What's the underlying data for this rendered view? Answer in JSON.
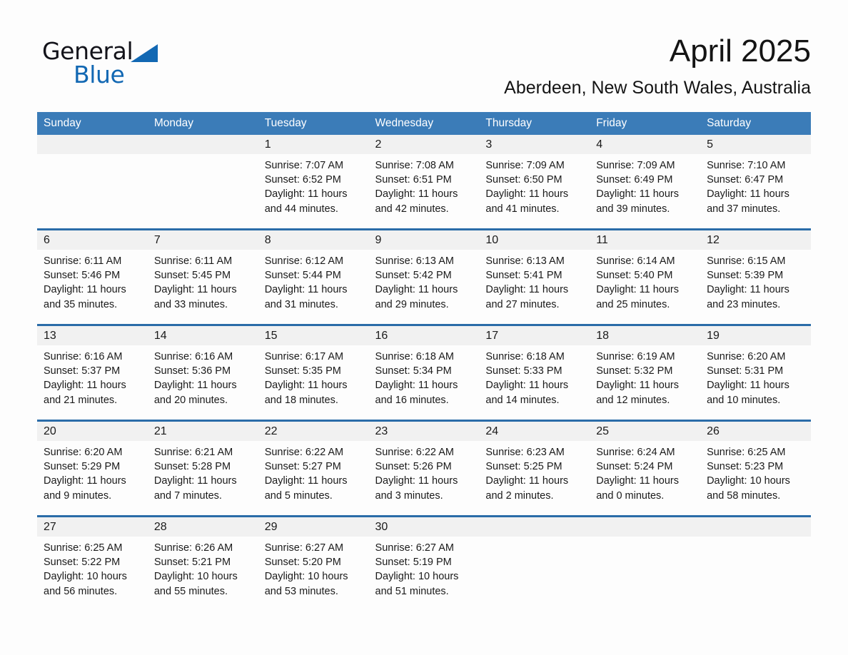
{
  "brand": {
    "name_part1": "General",
    "name_part2": "Blue",
    "accent_color": "#1268b3",
    "triangle_icon": "brand-triangle-icon"
  },
  "header": {
    "title": "April 2025",
    "subtitle": "Aberdeen, New South Wales, Australia"
  },
  "theme": {
    "header_row_blue": "#3b7cb8",
    "row_separator_blue": "#2a6ca8",
    "daynum_band_grey": "#f1f1f1",
    "page_background": "#fdfdfd",
    "text_color": "#1a1a1a"
  },
  "weekday_headers": [
    "Sunday",
    "Monday",
    "Tuesday",
    "Wednesday",
    "Thursday",
    "Friday",
    "Saturday"
  ],
  "labels": {
    "sunrise_prefix": "Sunrise:",
    "sunset_prefix": "Sunset:",
    "daylight_prefix": "Daylight:"
  },
  "weeks": [
    [
      {
        "day": "",
        "sunrise": "",
        "sunset": "",
        "daylight": ""
      },
      {
        "day": "",
        "sunrise": "",
        "sunset": "",
        "daylight": ""
      },
      {
        "day": "1",
        "sunrise": "Sunrise: 7:07 AM",
        "sunset": "Sunset: 6:52 PM",
        "daylight": "Daylight: 11 hours and 44 minutes."
      },
      {
        "day": "2",
        "sunrise": "Sunrise: 7:08 AM",
        "sunset": "Sunset: 6:51 PM",
        "daylight": "Daylight: 11 hours and 42 minutes."
      },
      {
        "day": "3",
        "sunrise": "Sunrise: 7:09 AM",
        "sunset": "Sunset: 6:50 PM",
        "daylight": "Daylight: 11 hours and 41 minutes."
      },
      {
        "day": "4",
        "sunrise": "Sunrise: 7:09 AM",
        "sunset": "Sunset: 6:49 PM",
        "daylight": "Daylight: 11 hours and 39 minutes."
      },
      {
        "day": "5",
        "sunrise": "Sunrise: 7:10 AM",
        "sunset": "Sunset: 6:47 PM",
        "daylight": "Daylight: 11 hours and 37 minutes."
      }
    ],
    [
      {
        "day": "6",
        "sunrise": "Sunrise: 6:11 AM",
        "sunset": "Sunset: 5:46 PM",
        "daylight": "Daylight: 11 hours and 35 minutes."
      },
      {
        "day": "7",
        "sunrise": "Sunrise: 6:11 AM",
        "sunset": "Sunset: 5:45 PM",
        "daylight": "Daylight: 11 hours and 33 minutes."
      },
      {
        "day": "8",
        "sunrise": "Sunrise: 6:12 AM",
        "sunset": "Sunset: 5:44 PM",
        "daylight": "Daylight: 11 hours and 31 minutes."
      },
      {
        "day": "9",
        "sunrise": "Sunrise: 6:13 AM",
        "sunset": "Sunset: 5:42 PM",
        "daylight": "Daylight: 11 hours and 29 minutes."
      },
      {
        "day": "10",
        "sunrise": "Sunrise: 6:13 AM",
        "sunset": "Sunset: 5:41 PM",
        "daylight": "Daylight: 11 hours and 27 minutes."
      },
      {
        "day": "11",
        "sunrise": "Sunrise: 6:14 AM",
        "sunset": "Sunset: 5:40 PM",
        "daylight": "Daylight: 11 hours and 25 minutes."
      },
      {
        "day": "12",
        "sunrise": "Sunrise: 6:15 AM",
        "sunset": "Sunset: 5:39 PM",
        "daylight": "Daylight: 11 hours and 23 minutes."
      }
    ],
    [
      {
        "day": "13",
        "sunrise": "Sunrise: 6:16 AM",
        "sunset": "Sunset: 5:37 PM",
        "daylight": "Daylight: 11 hours and 21 minutes."
      },
      {
        "day": "14",
        "sunrise": "Sunrise: 6:16 AM",
        "sunset": "Sunset: 5:36 PM",
        "daylight": "Daylight: 11 hours and 20 minutes."
      },
      {
        "day": "15",
        "sunrise": "Sunrise: 6:17 AM",
        "sunset": "Sunset: 5:35 PM",
        "daylight": "Daylight: 11 hours and 18 minutes."
      },
      {
        "day": "16",
        "sunrise": "Sunrise: 6:18 AM",
        "sunset": "Sunset: 5:34 PM",
        "daylight": "Daylight: 11 hours and 16 minutes."
      },
      {
        "day": "17",
        "sunrise": "Sunrise: 6:18 AM",
        "sunset": "Sunset: 5:33 PM",
        "daylight": "Daylight: 11 hours and 14 minutes."
      },
      {
        "day": "18",
        "sunrise": "Sunrise: 6:19 AM",
        "sunset": "Sunset: 5:32 PM",
        "daylight": "Daylight: 11 hours and 12 minutes."
      },
      {
        "day": "19",
        "sunrise": "Sunrise: 6:20 AM",
        "sunset": "Sunset: 5:31 PM",
        "daylight": "Daylight: 11 hours and 10 minutes."
      }
    ],
    [
      {
        "day": "20",
        "sunrise": "Sunrise: 6:20 AM",
        "sunset": "Sunset: 5:29 PM",
        "daylight": "Daylight: 11 hours and 9 minutes."
      },
      {
        "day": "21",
        "sunrise": "Sunrise: 6:21 AM",
        "sunset": "Sunset: 5:28 PM",
        "daylight": "Daylight: 11 hours and 7 minutes."
      },
      {
        "day": "22",
        "sunrise": "Sunrise: 6:22 AM",
        "sunset": "Sunset: 5:27 PM",
        "daylight": "Daylight: 11 hours and 5 minutes."
      },
      {
        "day": "23",
        "sunrise": "Sunrise: 6:22 AM",
        "sunset": "Sunset: 5:26 PM",
        "daylight": "Daylight: 11 hours and 3 minutes."
      },
      {
        "day": "24",
        "sunrise": "Sunrise: 6:23 AM",
        "sunset": "Sunset: 5:25 PM",
        "daylight": "Daylight: 11 hours and 2 minutes."
      },
      {
        "day": "25",
        "sunrise": "Sunrise: 6:24 AM",
        "sunset": "Sunset: 5:24 PM",
        "daylight": "Daylight: 11 hours and 0 minutes."
      },
      {
        "day": "26",
        "sunrise": "Sunrise: 6:25 AM",
        "sunset": "Sunset: 5:23 PM",
        "daylight": "Daylight: 10 hours and 58 minutes."
      }
    ],
    [
      {
        "day": "27",
        "sunrise": "Sunrise: 6:25 AM",
        "sunset": "Sunset: 5:22 PM",
        "daylight": "Daylight: 10 hours and 56 minutes."
      },
      {
        "day": "28",
        "sunrise": "Sunrise: 6:26 AM",
        "sunset": "Sunset: 5:21 PM",
        "daylight": "Daylight: 10 hours and 55 minutes."
      },
      {
        "day": "29",
        "sunrise": "Sunrise: 6:27 AM",
        "sunset": "Sunset: 5:20 PM",
        "daylight": "Daylight: 10 hours and 53 minutes."
      },
      {
        "day": "30",
        "sunrise": "Sunrise: 6:27 AM",
        "sunset": "Sunset: 5:19 PM",
        "daylight": "Daylight: 10 hours and 51 minutes."
      },
      {
        "day": "",
        "sunrise": "",
        "sunset": "",
        "daylight": ""
      },
      {
        "day": "",
        "sunrise": "",
        "sunset": "",
        "daylight": ""
      },
      {
        "day": "",
        "sunrise": "",
        "sunset": "",
        "daylight": ""
      }
    ]
  ]
}
